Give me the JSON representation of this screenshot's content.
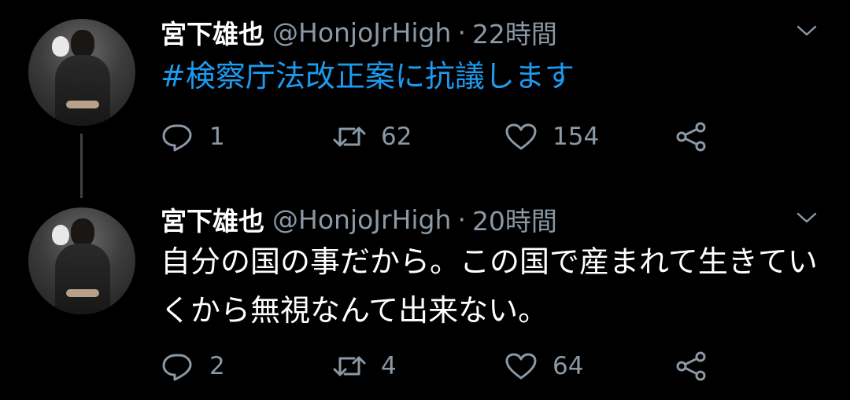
{
  "tweets": [
    {
      "name": "宮下雄也",
      "handle": "@HonjoJrHigh",
      "separator": "·",
      "time": "22時間",
      "hashtag": "#検察庁法改正案に抗議します",
      "text": "",
      "replies": "1",
      "retweets": "62",
      "likes": "154"
    },
    {
      "name": "宮下雄也",
      "handle": "@HonjoJrHigh",
      "separator": "·",
      "time": "20時間",
      "hashtag": "",
      "text": "自分の国の事だから。この国で産まれて生きていくから無視なんて出来ない。",
      "replies": "2",
      "retweets": "4",
      "likes": "64"
    }
  ],
  "colors": {
    "background": "#000000",
    "name": "#ffffff",
    "secondary_text": "#8b98a5",
    "hashtag": "#1d9bf0",
    "thread_line": "#3d4147"
  },
  "icons": {
    "reply": "reply-icon",
    "retweet": "retweet-icon",
    "like": "heart-icon",
    "share": "share-icon",
    "menu": "chevron-down-icon"
  }
}
